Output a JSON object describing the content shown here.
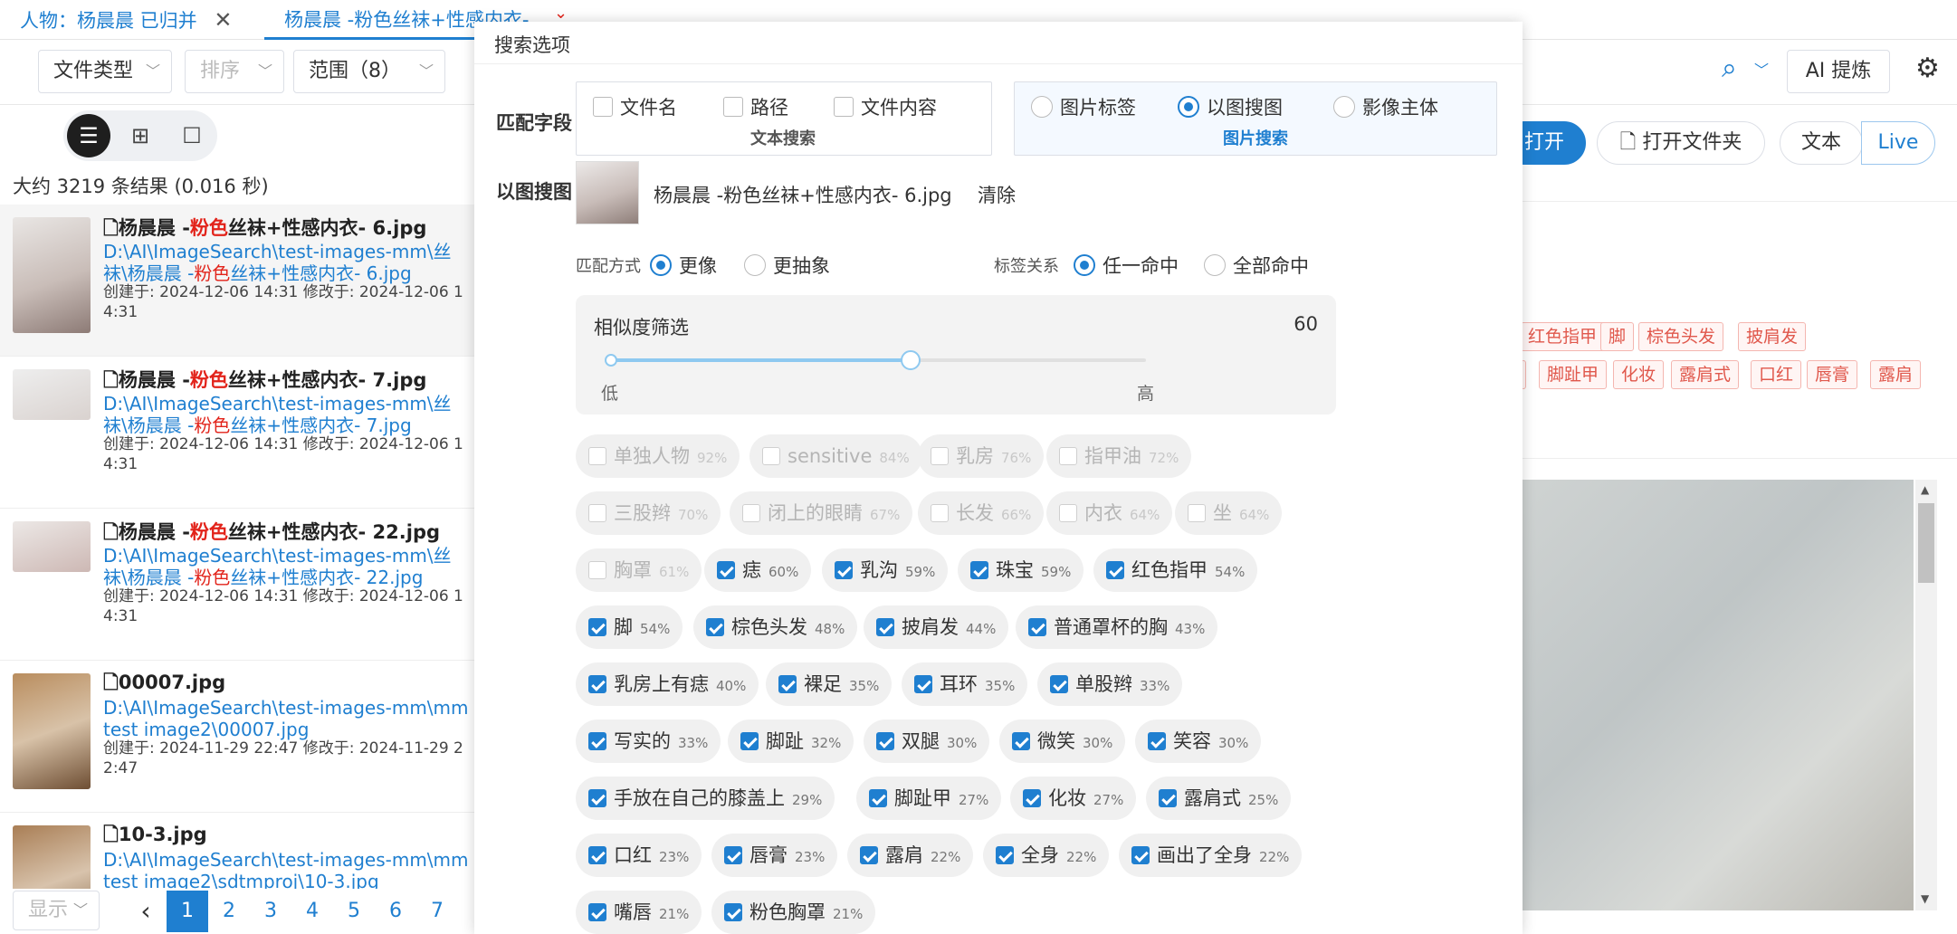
{
  "tabs": [
    {
      "label": "人物：杨晨晨 已归并"
    },
    {
      "label": "杨晨晨 -粉色丝袜+性感内衣-"
    }
  ],
  "toolbar": {
    "file_type": "文件类型",
    "sort": "排序",
    "scope": "范围（8）",
    "ai_button": "AI 提炼"
  },
  "results": {
    "stats": "大约 3219 条结果 (0.016 秒)",
    "items": [
      {
        "title_pre": "杨晨晨 -",
        "title_hl": "粉色",
        "title_post": "丝袜+性感内衣- 6.jpg",
        "path_pre": "D:\\AI\\ImageSearch\\test-images-mm\\丝袜\\杨晨晨 -",
        "path_hl": "粉色",
        "path_post": "丝袜+性感内衣- 6.jpg",
        "meta": "创建于: 2024-12-06 14:31 修改于: 2024-12-06 14:31"
      },
      {
        "title_pre": "杨晨晨 -",
        "title_hl": "粉色",
        "title_post": "丝袜+性感内衣- 7.jpg",
        "path_pre": "D:\\AI\\ImageSearch\\test-images-mm\\丝袜\\杨晨晨 -",
        "path_hl": "粉色",
        "path_post": "丝袜+性感内衣- 7.jpg",
        "meta": "创建于: 2024-12-06 14:31 修改于: 2024-12-06 14:31"
      },
      {
        "title_pre": "杨晨晨 -",
        "title_hl": "粉色",
        "title_post": "丝袜+性感内衣- 22.jpg",
        "path_pre": "D:\\AI\\ImageSearch\\test-images-mm\\丝袜\\杨晨晨 -",
        "path_hl": "粉色",
        "path_post": "丝袜+性感内衣- 22.jpg",
        "meta": "创建于: 2024-12-06 14:31 修改于: 2024-12-06 14:31"
      },
      {
        "title_pre": "00007.jpg",
        "title_hl": "",
        "title_post": "",
        "path_pre": "D:\\AI\\ImageSearch\\test-images-mm\\mm test image2\\00007.jpg",
        "path_hl": "",
        "path_post": "",
        "meta": "创建于: 2024-11-29 22:47 修改于: 2024-11-29 22:47"
      },
      {
        "title_pre": "10-3.jpg",
        "title_hl": "",
        "title_post": "",
        "path_pre": "D:\\AI\\ImageSearch\\test-images-mm\\mm test image2\\sdtmproj\\10-3.jpg",
        "path_hl": "",
        "path_post": "",
        "meta": ""
      }
    ]
  },
  "pager": {
    "show": "显示",
    "prev": "‹",
    "pages": [
      "1",
      "2",
      "3",
      "4",
      "5",
      "6",
      "7"
    ]
  },
  "right": {
    "open": "打开",
    "open_folder": "打开文件夹",
    "text": "文本",
    "live": "Live",
    "tags_row1": [
      "红色指甲",
      "脚",
      "棕色头发",
      "披肩发"
    ],
    "tags_row2": [
      "脚趾甲",
      "化妆",
      "露肩式",
      "口红",
      "唇膏",
      "露肩"
    ]
  },
  "dialog": {
    "title": "搜索选项",
    "match_field_label": "匹配字段",
    "text_options": [
      "文件名",
      "路径",
      "文件内容"
    ],
    "text_group": "文本搜索",
    "image_options": [
      "图片标签",
      "以图搜图",
      "影像主体"
    ],
    "image_group": "图片搜索",
    "image_search_label": "以图搜图",
    "image_file": "杨晨晨 -粉色丝袜+性感内衣- 6.jpg",
    "clear": "清除",
    "match_mode_label": "匹配方式",
    "match_modes": [
      "更像",
      "更抽象"
    ],
    "tag_relation_label": "标签关系",
    "tag_relations": [
      "任一命中",
      "全部命中"
    ],
    "similarity_label": "相似度筛选",
    "similarity_value": "60",
    "similarity_fraction": 0.6,
    "low": "低",
    "high": "高",
    "tags": [
      {
        "name": "单独人物",
        "pct": "92%",
        "checked": false
      },
      {
        "name": "sensitive",
        "pct": "84%",
        "checked": false
      },
      {
        "name": "乳房",
        "pct": "76%",
        "checked": false
      },
      {
        "name": "指甲油",
        "pct": "72%",
        "checked": false
      },
      {
        "name": "三股辫",
        "pct": "70%",
        "checked": false
      },
      {
        "name": "闭上的眼睛",
        "pct": "67%",
        "checked": false
      },
      {
        "name": "长发",
        "pct": "66%",
        "checked": false
      },
      {
        "name": "内衣",
        "pct": "64%",
        "checked": false
      },
      {
        "name": "坐",
        "pct": "64%",
        "checked": false
      },
      {
        "name": "胸罩",
        "pct": "61%",
        "checked": false
      },
      {
        "name": "痣",
        "pct": "60%",
        "checked": true
      },
      {
        "name": "乳沟",
        "pct": "59%",
        "checked": true
      },
      {
        "name": "珠宝",
        "pct": "59%",
        "checked": true
      },
      {
        "name": "红色指甲",
        "pct": "54%",
        "checked": true
      },
      {
        "name": "脚",
        "pct": "54%",
        "checked": true
      },
      {
        "name": "棕色头发",
        "pct": "48%",
        "checked": true
      },
      {
        "name": "披肩发",
        "pct": "44%",
        "checked": true
      },
      {
        "name": "普通罩杯的胸",
        "pct": "43%",
        "checked": true
      },
      {
        "name": "乳房上有痣",
        "pct": "40%",
        "checked": true
      },
      {
        "name": "裸足",
        "pct": "35%",
        "checked": true
      },
      {
        "name": "耳环",
        "pct": "35%",
        "checked": true
      },
      {
        "name": "单股辫",
        "pct": "33%",
        "checked": true
      },
      {
        "name": "写实的",
        "pct": "33%",
        "checked": true
      },
      {
        "name": "脚趾",
        "pct": "32%",
        "checked": true
      },
      {
        "name": "双腿",
        "pct": "30%",
        "checked": true
      },
      {
        "name": "微笑",
        "pct": "30%",
        "checked": true
      },
      {
        "name": "笑容",
        "pct": "30%",
        "checked": true
      },
      {
        "name": "手放在自己的膝盖上",
        "pct": "29%",
        "checked": true
      },
      {
        "name": "脚趾甲",
        "pct": "27%",
        "checked": true
      },
      {
        "name": "化妆",
        "pct": "27%",
        "checked": true
      },
      {
        "name": "露肩式",
        "pct": "25%",
        "checked": true
      },
      {
        "name": "口红",
        "pct": "23%",
        "checked": true
      },
      {
        "name": "唇膏",
        "pct": "23%",
        "checked": true
      },
      {
        "name": "露肩",
        "pct": "22%",
        "checked": true
      },
      {
        "name": "全身",
        "pct": "22%",
        "checked": true
      },
      {
        "name": "画出了全身",
        "pct": "22%",
        "checked": true
      },
      {
        "name": "嘴唇",
        "pct": "21%",
        "checked": true
      },
      {
        "name": "粉色胸罩",
        "pct": "21%",
        "checked": true
      }
    ]
  },
  "colors": {
    "accent": "#1f7fd0",
    "highlight": "#e2231a"
  },
  "icons": [
    "close-icon",
    "search-icon",
    "chevron-down-icon",
    "gear-icon",
    "list-view-icon",
    "grid-view-icon",
    "square-view-icon",
    "file-icon"
  ]
}
